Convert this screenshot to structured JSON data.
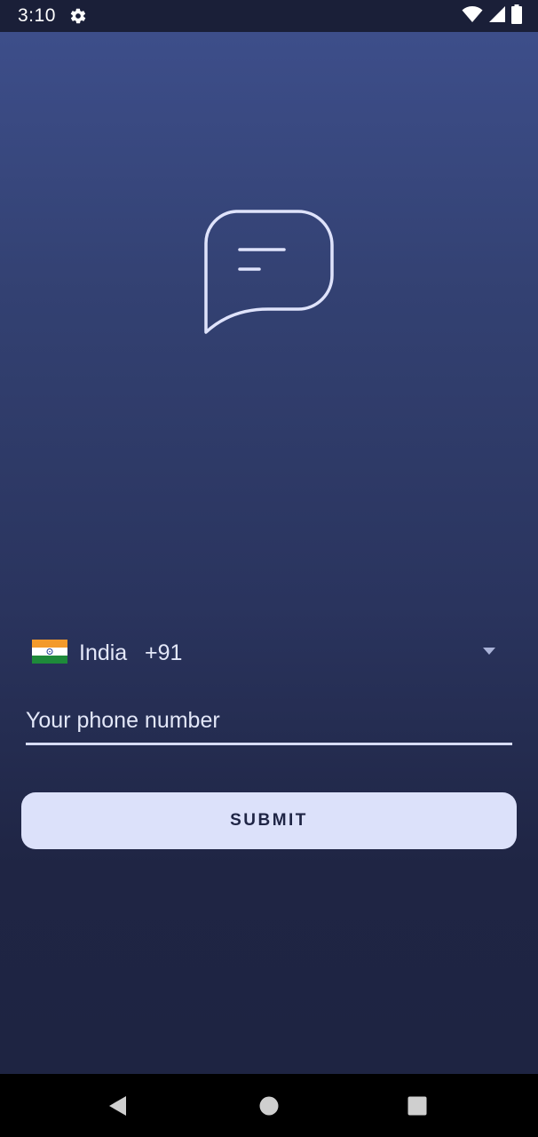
{
  "status_bar": {
    "time": "3:10",
    "icons": [
      "settings-gear-icon",
      "wifi-icon",
      "signal-icon",
      "battery-icon"
    ]
  },
  "logo": {
    "icon": "chat-bubble-icon"
  },
  "country_selector": {
    "flag_icon": "india-flag-icon",
    "country": "India",
    "dial_code": "+91",
    "dropdown_icon": "caret-down-icon"
  },
  "phone": {
    "value": "",
    "placeholder": "Your phone number"
  },
  "submit": {
    "label": "SUBMIT"
  },
  "nav_bar": {
    "icons": [
      "back-icon",
      "home-icon",
      "recents-icon"
    ]
  },
  "colors": {
    "background_top": "#3d4e8a",
    "background_bottom": "#1e2442",
    "button_bg": "#dce1fa",
    "button_text": "#1f2545",
    "text": "#e3e7f8"
  }
}
